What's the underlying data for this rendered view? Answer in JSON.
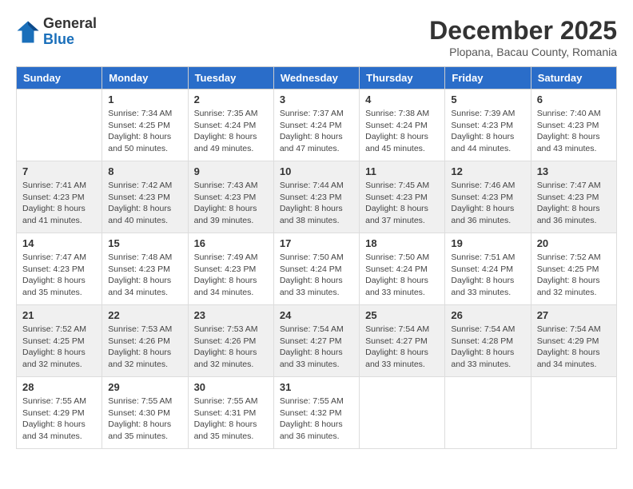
{
  "header": {
    "logo_line1": "General",
    "logo_line2": "Blue",
    "month_title": "December 2025",
    "location": "Plopana, Bacau County, Romania"
  },
  "weekdays": [
    "Sunday",
    "Monday",
    "Tuesday",
    "Wednesday",
    "Thursday",
    "Friday",
    "Saturday"
  ],
  "weeks": [
    [
      {
        "day": "",
        "info": ""
      },
      {
        "day": "1",
        "info": "Sunrise: 7:34 AM\nSunset: 4:25 PM\nDaylight: 8 hours\nand 50 minutes."
      },
      {
        "day": "2",
        "info": "Sunrise: 7:35 AM\nSunset: 4:24 PM\nDaylight: 8 hours\nand 49 minutes."
      },
      {
        "day": "3",
        "info": "Sunrise: 7:37 AM\nSunset: 4:24 PM\nDaylight: 8 hours\nand 47 minutes."
      },
      {
        "day": "4",
        "info": "Sunrise: 7:38 AM\nSunset: 4:24 PM\nDaylight: 8 hours\nand 45 minutes."
      },
      {
        "day": "5",
        "info": "Sunrise: 7:39 AM\nSunset: 4:23 PM\nDaylight: 8 hours\nand 44 minutes."
      },
      {
        "day": "6",
        "info": "Sunrise: 7:40 AM\nSunset: 4:23 PM\nDaylight: 8 hours\nand 43 minutes."
      }
    ],
    [
      {
        "day": "7",
        "info": "Sunrise: 7:41 AM\nSunset: 4:23 PM\nDaylight: 8 hours\nand 41 minutes."
      },
      {
        "day": "8",
        "info": "Sunrise: 7:42 AM\nSunset: 4:23 PM\nDaylight: 8 hours\nand 40 minutes."
      },
      {
        "day": "9",
        "info": "Sunrise: 7:43 AM\nSunset: 4:23 PM\nDaylight: 8 hours\nand 39 minutes."
      },
      {
        "day": "10",
        "info": "Sunrise: 7:44 AM\nSunset: 4:23 PM\nDaylight: 8 hours\nand 38 minutes."
      },
      {
        "day": "11",
        "info": "Sunrise: 7:45 AM\nSunset: 4:23 PM\nDaylight: 8 hours\nand 37 minutes."
      },
      {
        "day": "12",
        "info": "Sunrise: 7:46 AM\nSunset: 4:23 PM\nDaylight: 8 hours\nand 36 minutes."
      },
      {
        "day": "13",
        "info": "Sunrise: 7:47 AM\nSunset: 4:23 PM\nDaylight: 8 hours\nand 36 minutes."
      }
    ],
    [
      {
        "day": "14",
        "info": "Sunrise: 7:47 AM\nSunset: 4:23 PM\nDaylight: 8 hours\nand 35 minutes."
      },
      {
        "day": "15",
        "info": "Sunrise: 7:48 AM\nSunset: 4:23 PM\nDaylight: 8 hours\nand 34 minutes."
      },
      {
        "day": "16",
        "info": "Sunrise: 7:49 AM\nSunset: 4:23 PM\nDaylight: 8 hours\nand 34 minutes."
      },
      {
        "day": "17",
        "info": "Sunrise: 7:50 AM\nSunset: 4:24 PM\nDaylight: 8 hours\nand 33 minutes."
      },
      {
        "day": "18",
        "info": "Sunrise: 7:50 AM\nSunset: 4:24 PM\nDaylight: 8 hours\nand 33 minutes."
      },
      {
        "day": "19",
        "info": "Sunrise: 7:51 AM\nSunset: 4:24 PM\nDaylight: 8 hours\nand 33 minutes."
      },
      {
        "day": "20",
        "info": "Sunrise: 7:52 AM\nSunset: 4:25 PM\nDaylight: 8 hours\nand 32 minutes."
      }
    ],
    [
      {
        "day": "21",
        "info": "Sunrise: 7:52 AM\nSunset: 4:25 PM\nDaylight: 8 hours\nand 32 minutes."
      },
      {
        "day": "22",
        "info": "Sunrise: 7:53 AM\nSunset: 4:26 PM\nDaylight: 8 hours\nand 32 minutes."
      },
      {
        "day": "23",
        "info": "Sunrise: 7:53 AM\nSunset: 4:26 PM\nDaylight: 8 hours\nand 32 minutes."
      },
      {
        "day": "24",
        "info": "Sunrise: 7:54 AM\nSunset: 4:27 PM\nDaylight: 8 hours\nand 33 minutes."
      },
      {
        "day": "25",
        "info": "Sunrise: 7:54 AM\nSunset: 4:27 PM\nDaylight: 8 hours\nand 33 minutes."
      },
      {
        "day": "26",
        "info": "Sunrise: 7:54 AM\nSunset: 4:28 PM\nDaylight: 8 hours\nand 33 minutes."
      },
      {
        "day": "27",
        "info": "Sunrise: 7:54 AM\nSunset: 4:29 PM\nDaylight: 8 hours\nand 34 minutes."
      }
    ],
    [
      {
        "day": "28",
        "info": "Sunrise: 7:55 AM\nSunset: 4:29 PM\nDaylight: 8 hours\nand 34 minutes."
      },
      {
        "day": "29",
        "info": "Sunrise: 7:55 AM\nSunset: 4:30 PM\nDaylight: 8 hours\nand 35 minutes."
      },
      {
        "day": "30",
        "info": "Sunrise: 7:55 AM\nSunset: 4:31 PM\nDaylight: 8 hours\nand 35 minutes."
      },
      {
        "day": "31",
        "info": "Sunrise: 7:55 AM\nSunset: 4:32 PM\nDaylight: 8 hours\nand 36 minutes."
      },
      {
        "day": "",
        "info": ""
      },
      {
        "day": "",
        "info": ""
      },
      {
        "day": "",
        "info": ""
      }
    ]
  ]
}
